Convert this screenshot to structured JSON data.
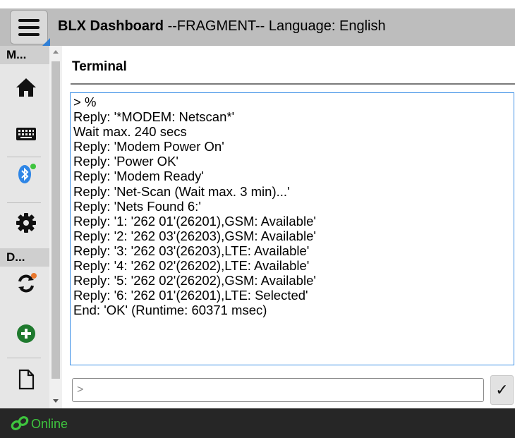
{
  "header": {
    "app_name": "BLX Dashboard",
    "subtitle": " --FRAGMENT-- Language: English"
  },
  "sidebar": {
    "section1_label": "M...",
    "section2_label": "D...",
    "items": [
      {
        "icon": "home-icon"
      },
      {
        "icon": "keyboard-icon"
      },
      {
        "icon": "bluetooth-icon",
        "badge_color": "#3ec43e"
      },
      {
        "icon": "gear-icon"
      },
      {
        "icon": "sync-icon",
        "badge_color": "#e8772e"
      },
      {
        "icon": "add-circle-icon"
      },
      {
        "icon": "file-icon"
      }
    ]
  },
  "main": {
    "title": "Terminal",
    "terminal_lines": [
      "> %",
      "Reply: '*MODEM: Netscan*'",
      "Wait max. 240 secs",
      "Reply: 'Modem Power On'",
      "Reply: 'Power OK'",
      "Reply: 'Modem Ready'",
      "Reply: 'Net-Scan (Wait max. 3 min)...'",
      "Reply: 'Nets Found 6:'",
      "Reply: '1: '262 01'(26201),GSM: Available'",
      "Reply: '2: '262 03'(26203),GSM: Available'",
      "Reply: '3: '262 03'(26203),LTE: Available'",
      "Reply: '4: '262 02'(26202),LTE: Available'",
      "Reply: '5: '262 02'(26202),GSM: Available'",
      "Reply: '6: '262 01'(26201),LTE: Selected'",
      "End: 'OK' (Runtime: 60371 msec)"
    ],
    "input_placeholder": ">",
    "send_label": "✓"
  },
  "footer": {
    "status": "Online",
    "status_color": "#3ec43e"
  }
}
